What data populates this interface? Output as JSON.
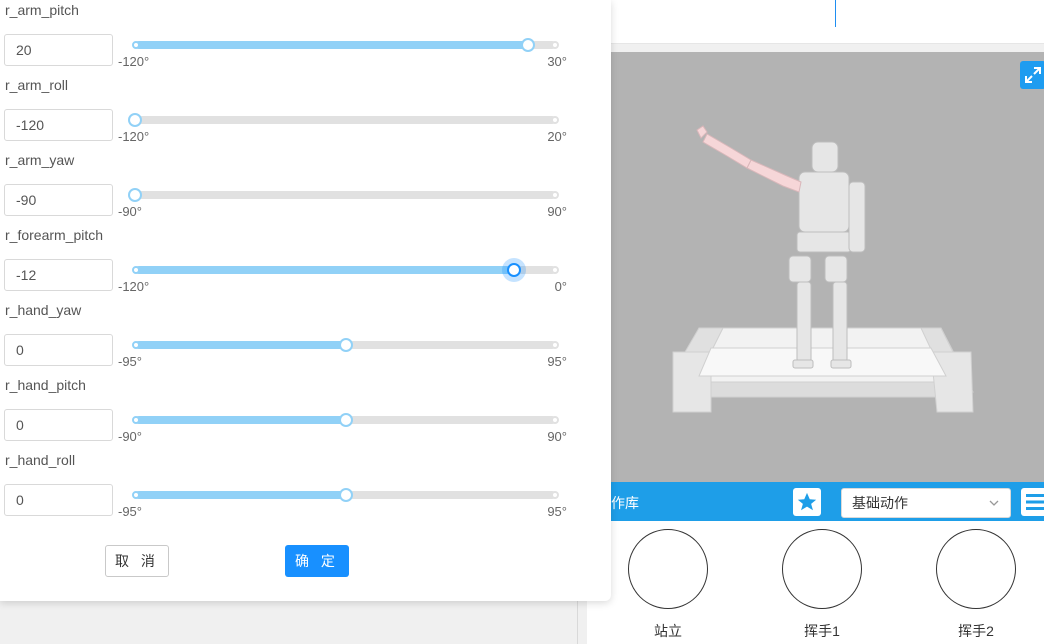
{
  "dialog": {
    "joints": [
      {
        "name": "r_arm_pitch",
        "value": "20",
        "min_label": "-120°",
        "max_label": "30°",
        "min": -120,
        "max": 30,
        "current": 20,
        "active": false
      },
      {
        "name": "r_arm_roll",
        "value": "-120",
        "min_label": "-120°",
        "max_label": "20°",
        "min": -120,
        "max": 20,
        "current": -120,
        "active": false
      },
      {
        "name": "r_arm_yaw",
        "value": "-90",
        "min_label": "-90°",
        "max_label": "90°",
        "min": -90,
        "max": 90,
        "current": -90,
        "active": false
      },
      {
        "name": "r_forearm_pitch",
        "value": "-12",
        "min_label": "-120°",
        "max_label": "0°",
        "min": -120,
        "max": 0,
        "current": -12,
        "active": true
      },
      {
        "name": "r_hand_yaw",
        "value": "0",
        "min_label": "-95°",
        "max_label": "95°",
        "min": -95,
        "max": 95,
        "current": 0,
        "active": false
      },
      {
        "name": "r_hand_pitch",
        "value": "0",
        "min_label": "-90°",
        "max_label": "90°",
        "min": -90,
        "max": 90,
        "current": 0,
        "active": false
      },
      {
        "name": "r_hand_roll",
        "value": "0",
        "min_label": "-95°",
        "max_label": "95°",
        "min": -95,
        "max": 95,
        "current": 0,
        "active": false
      }
    ],
    "cancel_label": "取 消",
    "ok_label": "确 定"
  },
  "library": {
    "title": "作库",
    "category_selected": "基础动作",
    "actions": [
      {
        "label": "站立"
      },
      {
        "label": "挥手1"
      },
      {
        "label": "挥手2"
      }
    ]
  },
  "colors": {
    "accent": "#1890ff",
    "slider_fill": "#91d1f7",
    "library_bar": "#1e9ee8",
    "viewport_bg": "#b3b3b3"
  }
}
